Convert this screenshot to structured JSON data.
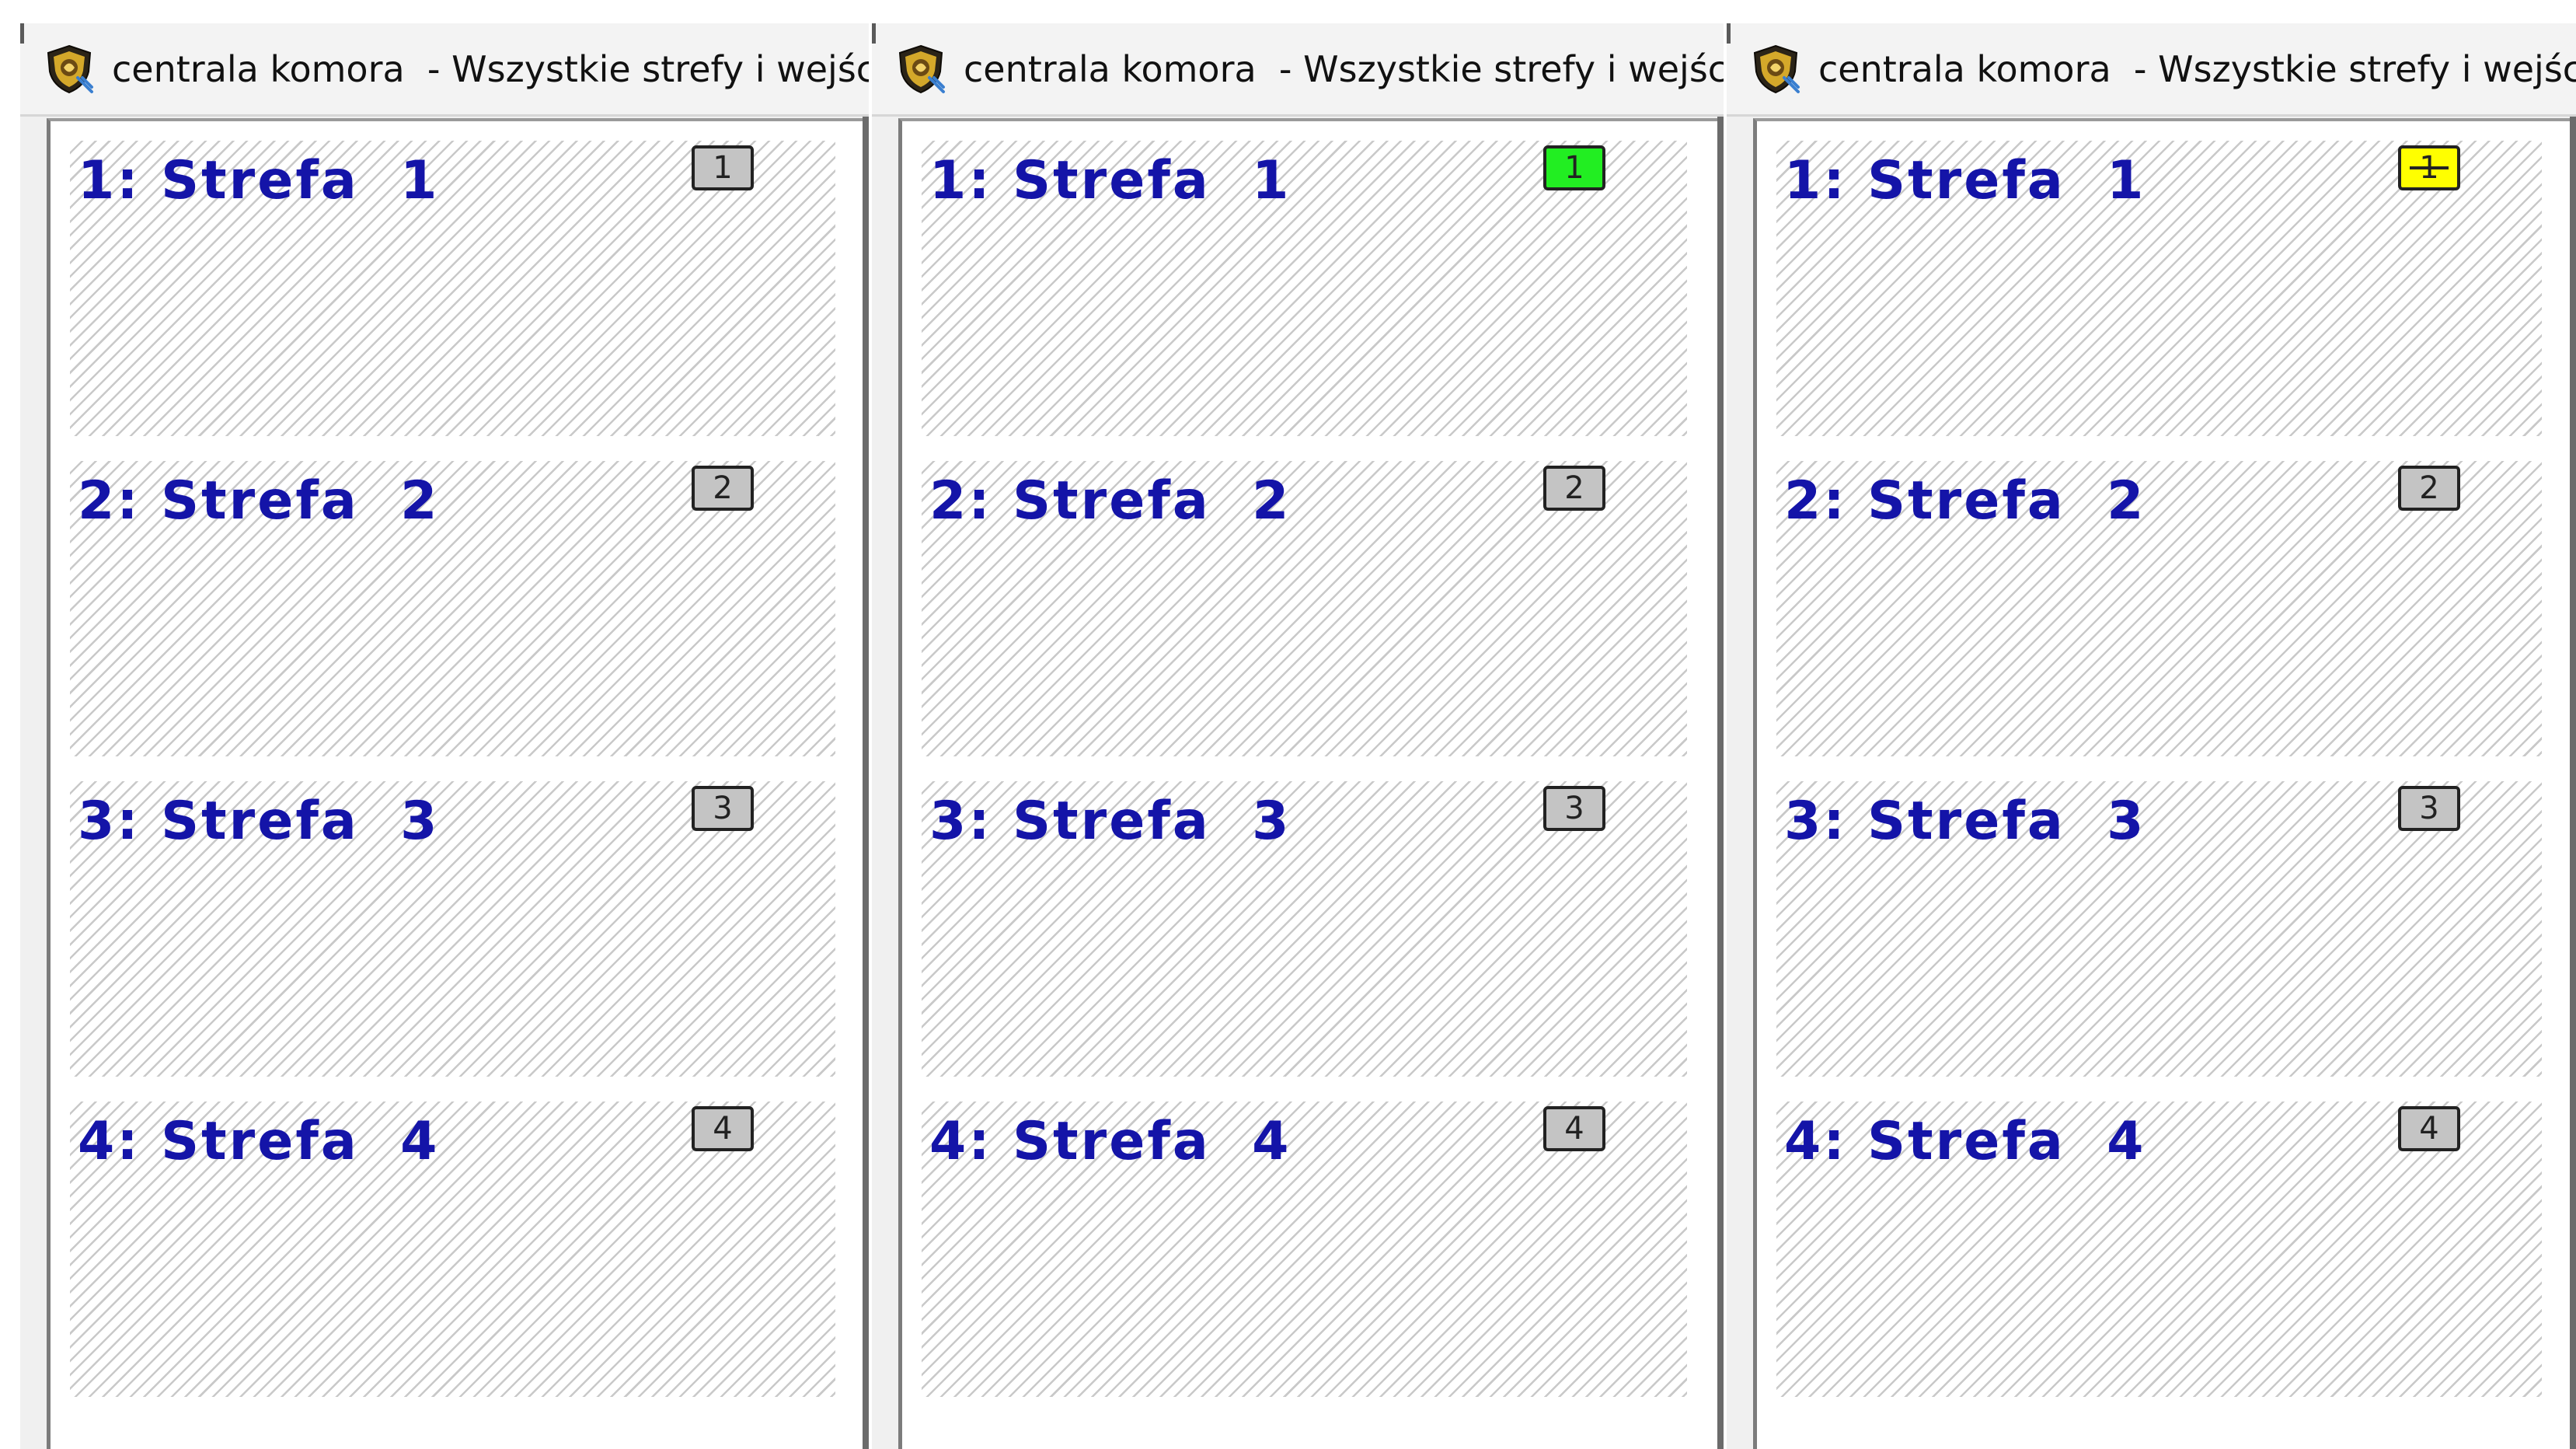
{
  "colors": {
    "zone_label": "#1414a8",
    "badge_gray": "#c4c4c4",
    "badge_green": "#22ee22",
    "badge_yellow": "#ffff00",
    "window_bg": "#f0f0f0",
    "hatch": "#c9c9c9"
  },
  "windows": [
    {
      "title": "centrala komora  - Wszystkie strefy i wejścia",
      "icon": "app-shield-icon",
      "zones": [
        {
          "label": "1: Strefa  1",
          "badge": "1",
          "badge_state": "gray"
        },
        {
          "label": "2: Strefa  2",
          "badge": "2",
          "badge_state": "gray"
        },
        {
          "label": "3: Strefa  3",
          "badge": "3",
          "badge_state": "gray"
        },
        {
          "label": "4: Strefa  4",
          "badge": "4",
          "badge_state": "gray"
        }
      ]
    },
    {
      "title": "centrala komora  - Wszystkie strefy i wejścia",
      "icon": "app-shield-icon",
      "zones": [
        {
          "label": "1: Strefa  1",
          "badge": "1",
          "badge_state": "green"
        },
        {
          "label": "2: Strefa  2",
          "badge": "2",
          "badge_state": "gray"
        },
        {
          "label": "3: Strefa  3",
          "badge": "3",
          "badge_state": "gray"
        },
        {
          "label": "4: Strefa  4",
          "badge": "4",
          "badge_state": "gray"
        }
      ]
    },
    {
      "title": "centrala komora  - Wszystkie strefy i wejścia",
      "icon": "app-shield-icon",
      "zones": [
        {
          "label": "1: Strefa  1",
          "badge": "1",
          "badge_state": "yellow-crossed"
        },
        {
          "label": "2: Strefa  2",
          "badge": "2",
          "badge_state": "gray"
        },
        {
          "label": "3: Strefa  3",
          "badge": "3",
          "badge_state": "gray"
        },
        {
          "label": "4: Strefa  4",
          "badge": "4",
          "badge_state": "gray"
        }
      ]
    }
  ]
}
